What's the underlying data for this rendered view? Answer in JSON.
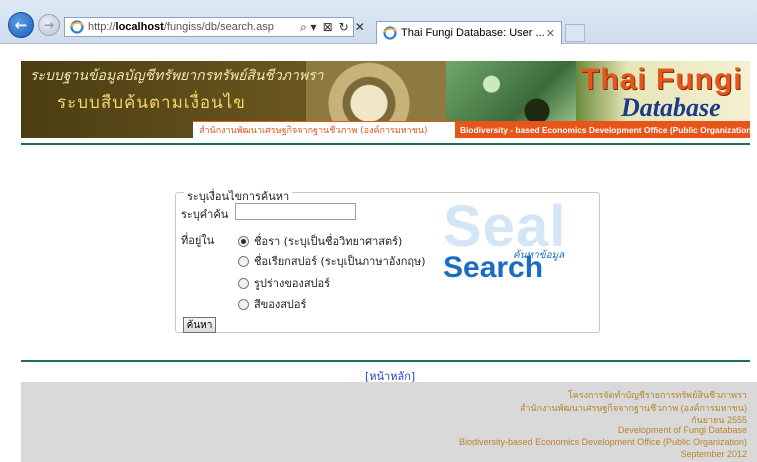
{
  "browser": {
    "url_prefix": "http://",
    "url_host": "localhost",
    "url_path": "/fungiss/db/search.asp",
    "tools": [
      "⌕ ▾",
      "⊠",
      "↻",
      "✕"
    ],
    "tab_title": "Thai Fungi Database: User ...",
    "tab_close": "✕"
  },
  "banner": {
    "thai_title_1": "ระบบฐานข้อมูลบัญชีทรัพยากรทรัพย์สินชีวภาพรา",
    "thai_title_2": "ระบบสืบค้นตามเงื่อนไข",
    "brand_1": "Thai Fungi",
    "brand_2": "Database",
    "strip_thai": "สำนักงานพัฒนาเศรษฐกิจจากฐานชีวภาพ (องค์การมหาชน)",
    "strip_en": "Biodiversity - based Economics Development Office (Public Organization)"
  },
  "form": {
    "legend": "ระบุเงื่อนไขการค้นหา",
    "name_label": "ระบุคำค้น",
    "name_value": "",
    "in_label": "ที่อยู่ใน",
    "options": [
      {
        "label": "ชื่อรา  (ระบุเป็นชื่อวิทยาศาสตร์)",
        "checked": true
      },
      {
        "label": "ชื่อเรียกสปอร์  (ระบุเป็นภาษาอังกฤษ)",
        "checked": false
      },
      {
        "label": "รูปร่างของสปอร์",
        "checked": false
      },
      {
        "label": "สีของสปอร์",
        "checked": false
      }
    ],
    "submit_label": "ค้นหา"
  },
  "logo": {
    "seal": "Seal",
    "search": "Search",
    "sub": "ค้นหาข้อมูล"
  },
  "home_link": "[หน้าหลัก]",
  "footer": {
    "lines": [
      "โครงการจัดทำบัญชีรายการทรัพย์สินชีวภาพรา",
      "สำนักงานพัฒนาเศรษฐกิจจากฐานชีวภาพ   (องค์การมหาชน)",
      "กันยายน  2555",
      "Development of Fungi Database",
      "Biodiversity-based Economics Development Office (Public Organization)",
      "September 2012"
    ]
  }
}
